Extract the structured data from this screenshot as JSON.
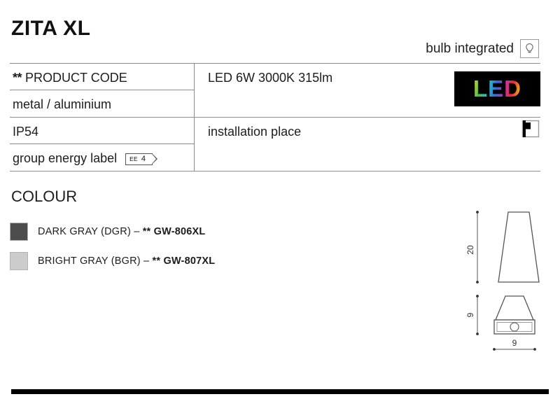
{
  "product": {
    "title": "ZITA XL",
    "bulb_note": "bulb integrated",
    "bulb_icon": "light-bulb-icon"
  },
  "spec_table": {
    "rows": [
      {
        "left": "** PRODUCT CODE",
        "left_has_stars": true,
        "right": "LED 6W 3000K 315lm"
      },
      {
        "left": "metal / aluminium",
        "left_has_stars": false,
        "right": ""
      },
      {
        "left": "IP54",
        "left_has_stars": false,
        "right": "installation place"
      },
      {
        "left": "group energy label",
        "left_has_stars": false,
        "right": ""
      }
    ],
    "energy_label": {
      "prefix": "EE",
      "value": "4"
    }
  },
  "badges": {
    "led_logo_text": "LED",
    "installation_icon": "wall-mount-icon"
  },
  "colour": {
    "heading": "COLOUR",
    "options": [
      {
        "name": "DARK GRAY (DGR)",
        "dash": "–",
        "stars": "**",
        "code": "GW-806XL",
        "swatch": "#4d4d4d"
      },
      {
        "name": "BRIGHT GRAY (BGR)",
        "dash": "–",
        "stars": "**",
        "code": "GW-807XL",
        "swatch": "#cccccc"
      }
    ]
  },
  "drawings": {
    "side_view": {
      "height_label": "20"
    },
    "front_view": {
      "height_label": "9",
      "width_label": "9"
    }
  },
  "colors": {
    "rule": "#8d8d8d",
    "text": "#1d1d1d",
    "bar": "#000000"
  }
}
